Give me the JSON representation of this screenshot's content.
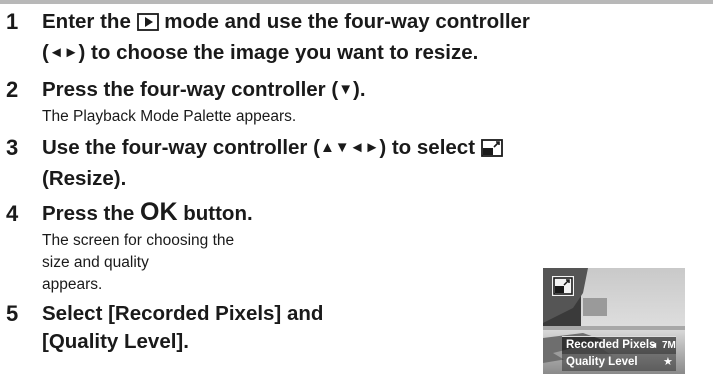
{
  "steps": [
    {
      "number": "1",
      "line1_a": "Enter the",
      "line1_b": "mode and use the four-way controller",
      "line2_a": "(",
      "line2_arrows": "◄►",
      "line2_b": ") to choose the image you want to resize."
    },
    {
      "number": "2",
      "title_a": "Press the four-way controller (",
      "title_arrow": "▼",
      "title_b": ").",
      "description": "The Playback Mode Palette appears."
    },
    {
      "number": "3",
      "line1_a": "Use the four-way controller (",
      "line1_arrows": "▲▼◄►",
      "line1_b": ") to select",
      "line2": "(Resize)."
    },
    {
      "number": "4",
      "title_a": "Press the",
      "title_ok": "OK",
      "title_b": "button.",
      "desc_line1": "The screen for choosing the size and quality",
      "desc_line2": "appears."
    },
    {
      "number": "5",
      "line1": "Select [Recorded Pixels] and",
      "line2": "[Quality Level]."
    }
  ],
  "camera_screen": {
    "row1_label": "Recorded Pixels",
    "row1_arrow": "◄",
    "row1_value": "7M",
    "row2_label": "Quality Level",
    "row2_value": "★"
  },
  "icons": [
    "playback-icon",
    "resize-icon"
  ]
}
